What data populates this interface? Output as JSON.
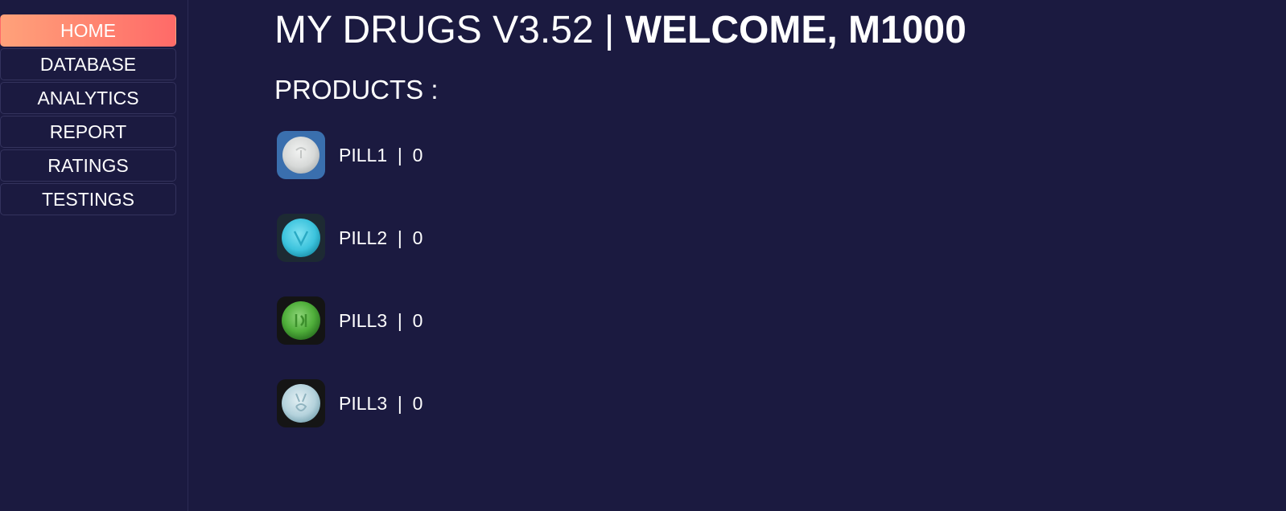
{
  "header": {
    "app_title": "MY DRUGS V3.52 | ",
    "welcome": "WELCOME, M1000"
  },
  "sidebar": {
    "items": [
      {
        "label": "HOME",
        "active": true
      },
      {
        "label": "DATABASE",
        "active": false
      },
      {
        "label": "ANALYTICS",
        "active": false
      },
      {
        "label": "REPORT",
        "active": false
      },
      {
        "label": "RATINGS",
        "active": false
      },
      {
        "label": "TESTINGS",
        "active": false
      }
    ]
  },
  "products": {
    "title": "PRODUCTS :",
    "items": [
      {
        "name": "PILL1",
        "separator": "  |  ",
        "count": "0",
        "icon": "white-pill-icon"
      },
      {
        "name": "PILL2",
        "separator": "  |  ",
        "count": "0",
        "icon": "blue-pill-icon"
      },
      {
        "name": "PILL3",
        "separator": "  |  ",
        "count": "0",
        "icon": "green-pill-icon"
      },
      {
        "name": "PILL3",
        "separator": "  |  ",
        "count": "0",
        "icon": "light-blue-pill-icon"
      }
    ]
  },
  "colors": {
    "background": "#1b1a40",
    "accent_start": "#ffa27a",
    "accent_end": "#ff6a68"
  }
}
